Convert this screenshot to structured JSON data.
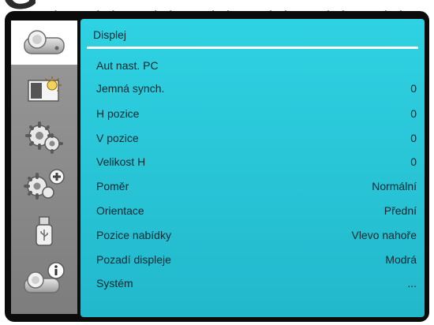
{
  "menu": {
    "title": "Displej",
    "items": [
      {
        "label": "Aut nast. PC",
        "value": ""
      },
      {
        "label": "Jemná synch.",
        "value": "0"
      },
      {
        "label": "H pozice",
        "value": "0"
      },
      {
        "label": "V pozice",
        "value": "0"
      },
      {
        "label": "Velikost H",
        "value": "0"
      },
      {
        "label": "Poměr",
        "value": "Normální"
      },
      {
        "label": "Orientace",
        "value": "Přední"
      },
      {
        "label": "Pozice nabídky",
        "value": "Vlevo nahoře"
      },
      {
        "label": "Pozadí displeje",
        "value": "Modrá"
      },
      {
        "label": "Systém",
        "value": "..."
      }
    ]
  },
  "sidebar": {
    "tabs": [
      {
        "icon": "display-icon",
        "active": true
      },
      {
        "icon": "picture-brightness-icon",
        "active": false
      },
      {
        "icon": "settings-gears-icon",
        "active": false
      },
      {
        "icon": "advanced-settings-icon",
        "active": false
      },
      {
        "icon": "usb-icon",
        "active": false
      },
      {
        "icon": "information-icon",
        "active": false
      }
    ]
  },
  "colors": {
    "panel": "#2fd2e2",
    "sidebar": "#8a8a8a",
    "frame": "#0b0b0b",
    "text": "#0d2830"
  }
}
